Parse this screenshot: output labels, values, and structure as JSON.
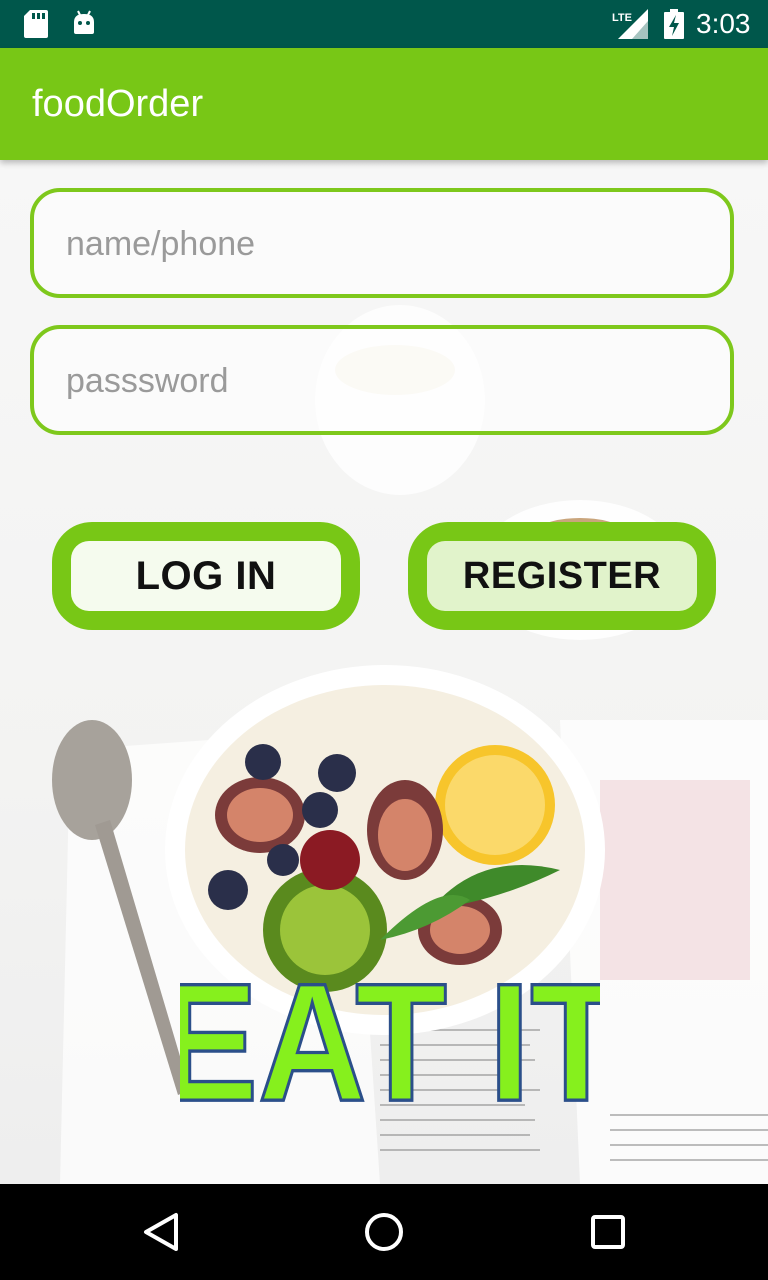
{
  "status_bar": {
    "time": "3:03",
    "network": "LTE",
    "icons": [
      "sd-card-icon",
      "android-icon",
      "lte-signal-icon",
      "battery-charging-icon"
    ]
  },
  "app_bar": {
    "title": "foodOrder",
    "color": "#78c716"
  },
  "login_form": {
    "username_placeholder": "name/phone",
    "username_value": "",
    "password_placeholder": "passsword",
    "password_value": "",
    "login_label": "LOG IN",
    "register_label": "REGISTER",
    "accent": "#7ec81c"
  },
  "brand": {
    "logo_text": "EAT IT",
    "logo_color": "#86f01d"
  },
  "nav_bar": {
    "icons": [
      "back-icon",
      "home-icon",
      "recents-icon"
    ]
  },
  "colors": {
    "status_bar": "#00574b",
    "primary": "#78c716"
  }
}
